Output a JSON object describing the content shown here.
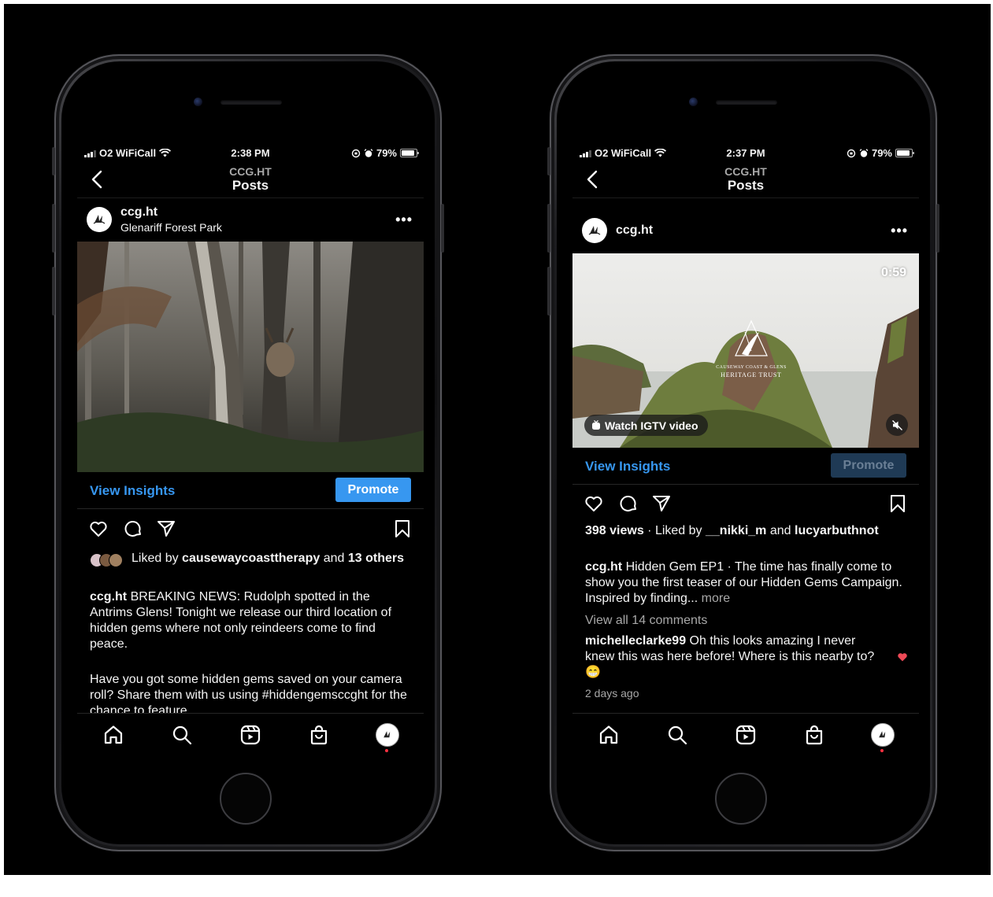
{
  "left": {
    "status": {
      "carrier": "O2 WiFiCall",
      "time": "2:38 PM",
      "battery": "79%"
    },
    "nav": {
      "subtitle": "CCG.HT",
      "title": "Posts"
    },
    "post": {
      "username": "ccg.ht",
      "location": "Glenariff Forest Park",
      "more": "•••",
      "view_insights": "View Insights",
      "promote": "Promote",
      "liked_prefix": "Liked by",
      "liked_user": "causewaycoasttherapy",
      "liked_and": "and",
      "liked_others": "13 others",
      "caption_user": "ccg.ht",
      "caption_text": "BREAKING NEWS: Rudolph spotted in the Antrims Glens! Tonight we release our third location of hidden gems where not only reindeers come to find peace.",
      "caption_text2": "Have you got some hidden gems saved on your camera roll? Share them with us using #hiddengemsccght for the chance to feature."
    }
  },
  "right": {
    "status": {
      "carrier": "O2 WiFiCall",
      "time": "2:37 PM",
      "battery": "79%"
    },
    "nav": {
      "subtitle": "CCG.HT",
      "title": "Posts"
    },
    "post": {
      "username": "ccg.ht",
      "more": "•••",
      "duration": "0:59",
      "watch_label": "Watch IGTV video",
      "logo_line1": "CAUSEWAY COAST & GLENS",
      "logo_line2": "HERITAGE TRUST",
      "view_insights": "View Insights",
      "promote": "Promote",
      "views": "398 views",
      "liked_prefix": "Liked by",
      "liked_user1": "__nikki_m",
      "liked_and": "and",
      "liked_user2": "lucyarbuthnot",
      "caption_user": "ccg.ht",
      "caption_text": "Hidden Gem EP1 · The time has finally come to show you the first teaser of our Hidden Gems Campaign. Inspired by finding...",
      "caption_more": "more",
      "view_comments": "View all 14 comments",
      "comment_user": "michelleclarke99",
      "comment_text": "Oh this looks amazing I never knew this was here before! Where is this nearby to? 😁",
      "timestamp": "2 days ago"
    }
  },
  "icons": [
    "signal-icon",
    "wifi-icon",
    "alarm-icon",
    "battery-icon",
    "back-icon",
    "more-icon",
    "heart-icon",
    "comment-icon",
    "share-icon",
    "bookmark-icon",
    "home-icon",
    "search-icon",
    "reels-icon",
    "shop-icon",
    "profile-icon",
    "mute-icon",
    "igtv-icon"
  ],
  "colors": {
    "link": "#3797f0",
    "background": "#000000",
    "notification": "#ff3040",
    "comment_like": "#ed4956"
  }
}
